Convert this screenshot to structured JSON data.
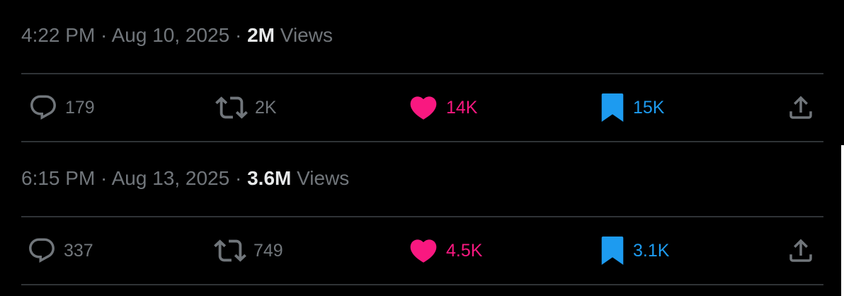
{
  "posts": [
    {
      "timestamp": "4:22 PM · Aug 10, 2025 · ",
      "views_count": "2M",
      "views_label": "Views",
      "actions": {
        "replies": "179",
        "reposts": "2K",
        "likes": "14K",
        "bookmarks": "15K"
      }
    },
    {
      "timestamp": "6:15 PM · Aug 13, 2025 · ",
      "views_count": "3.6M",
      "views_label": "Views",
      "actions": {
        "replies": "337",
        "reposts": "749",
        "likes": "4.5K",
        "bookmarks": "3.1K"
      }
    }
  ],
  "icons": {
    "reply": "reply-icon",
    "repost": "repost-icon",
    "like": "heart-icon",
    "bookmark": "bookmark-icon",
    "share": "share-icon"
  },
  "colors": {
    "background": "#000000",
    "text_secondary": "#71767b",
    "text_primary": "#e7e9ea",
    "like_pink": "#f91880",
    "bookmark_blue": "#1d9bf0",
    "divider": "#2f3336"
  }
}
